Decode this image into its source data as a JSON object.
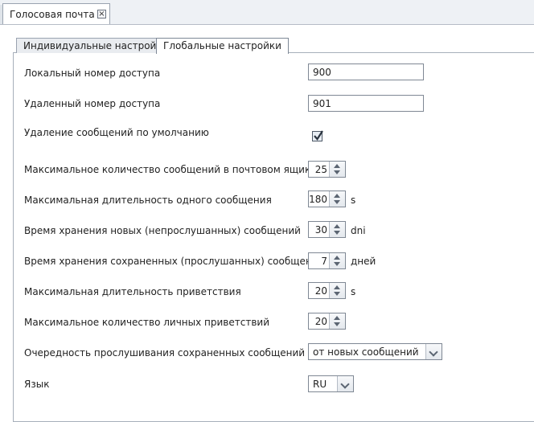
{
  "document_tab": {
    "title": "Голосовая почта",
    "close_symbol": "⊠"
  },
  "tabs": [
    {
      "label": "Индивидуальные настройки",
      "active": false
    },
    {
      "label": "Глобальные настройки",
      "active": true
    }
  ],
  "fields": {
    "local_access_number": {
      "label": "Локальный номер доступа",
      "value": "900"
    },
    "remote_access_number": {
      "label": "Удаленный номер доступа",
      "value": "901"
    },
    "delete_messages_default": {
      "label": "Удаление сообщений по умолчанию",
      "checked": true
    },
    "max_messages": {
      "label": "Максимальное количество сообщений в почтовом ящике",
      "value": "25",
      "unit": ""
    },
    "max_message_length": {
      "label": "Максимальная длительность одного сообщения",
      "value": "180",
      "unit": "s"
    },
    "new_retention": {
      "label": "Время хранения новых (непрослушанных) сообщений",
      "value": "30",
      "unit": "dni"
    },
    "saved_retention": {
      "label": "Время хранения сохраненных (прослушанных) сообщений",
      "value": "7",
      "unit": "дней"
    },
    "max_greeting_length": {
      "label": "Максимальная длительность приветствия",
      "value": "20",
      "unit": "s"
    },
    "max_personal_greetings": {
      "label": "Максимальное количество личных приветствий",
      "value": "20",
      "unit": ""
    },
    "playback_order": {
      "label": "Очередность прослушивания сохраненных сообщений",
      "value": "от новых сообщений"
    },
    "language": {
      "label": "Язык",
      "value": "RU"
    }
  }
}
